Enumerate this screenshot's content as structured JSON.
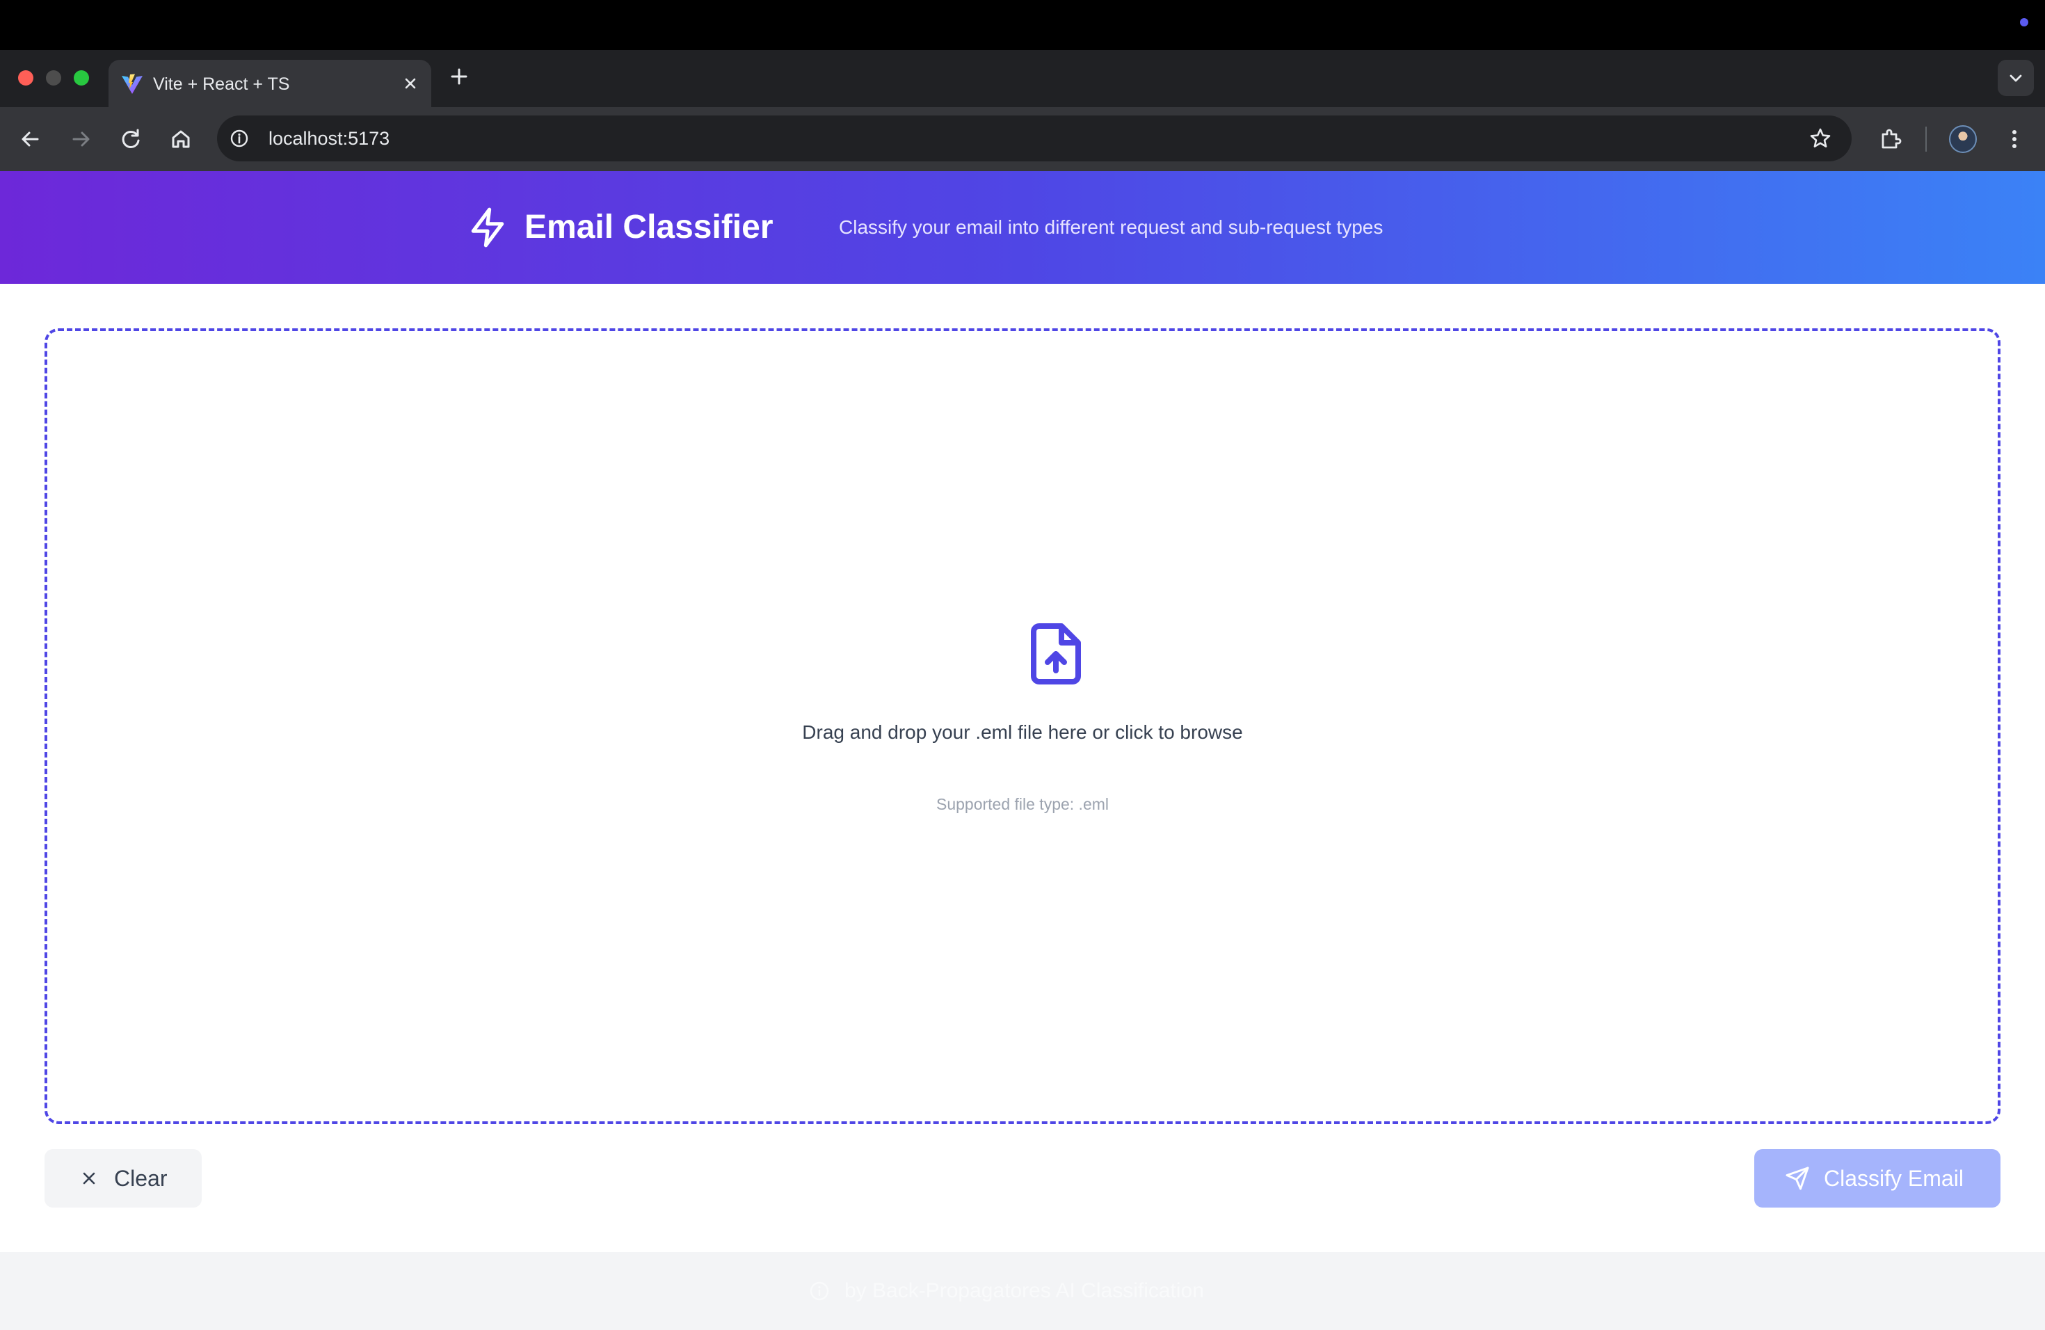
{
  "browser": {
    "tab": {
      "title": "Vite + React + TS",
      "favicon": "vite-logo-icon"
    },
    "address_bar": {
      "url": "localhost:5173"
    },
    "icons": [
      "back-arrow-icon",
      "forward-arrow-icon",
      "reload-icon",
      "home-icon",
      "site-info-icon",
      "bookmark-star-icon",
      "extensions-puzzle-icon",
      "profile-avatar",
      "more-vert-icon",
      "close-icon",
      "plus-icon",
      "chevron-down-icon"
    ]
  },
  "header": {
    "title": "Email Classifier",
    "subtitle": "Classify your email into different request and sub-request types",
    "icon": "lightning-bolt-icon"
  },
  "dropzone": {
    "prompt": "Drag and drop your .eml file here or click to browse",
    "hint": "Supported file type: .eml",
    "icon": "file-upload-icon"
  },
  "actions": {
    "clear_label": "Clear",
    "classify_label": "Classify Email"
  },
  "footer": {
    "text": "by Back-Propagatores AI Classification",
    "icon": "info-circle-icon"
  },
  "colors": {
    "accent": "#4f46e5",
    "header_gradient_start": "#6d28d9",
    "header_gradient_end": "#3b82f6",
    "button_disabled": "#a5b4fc"
  }
}
